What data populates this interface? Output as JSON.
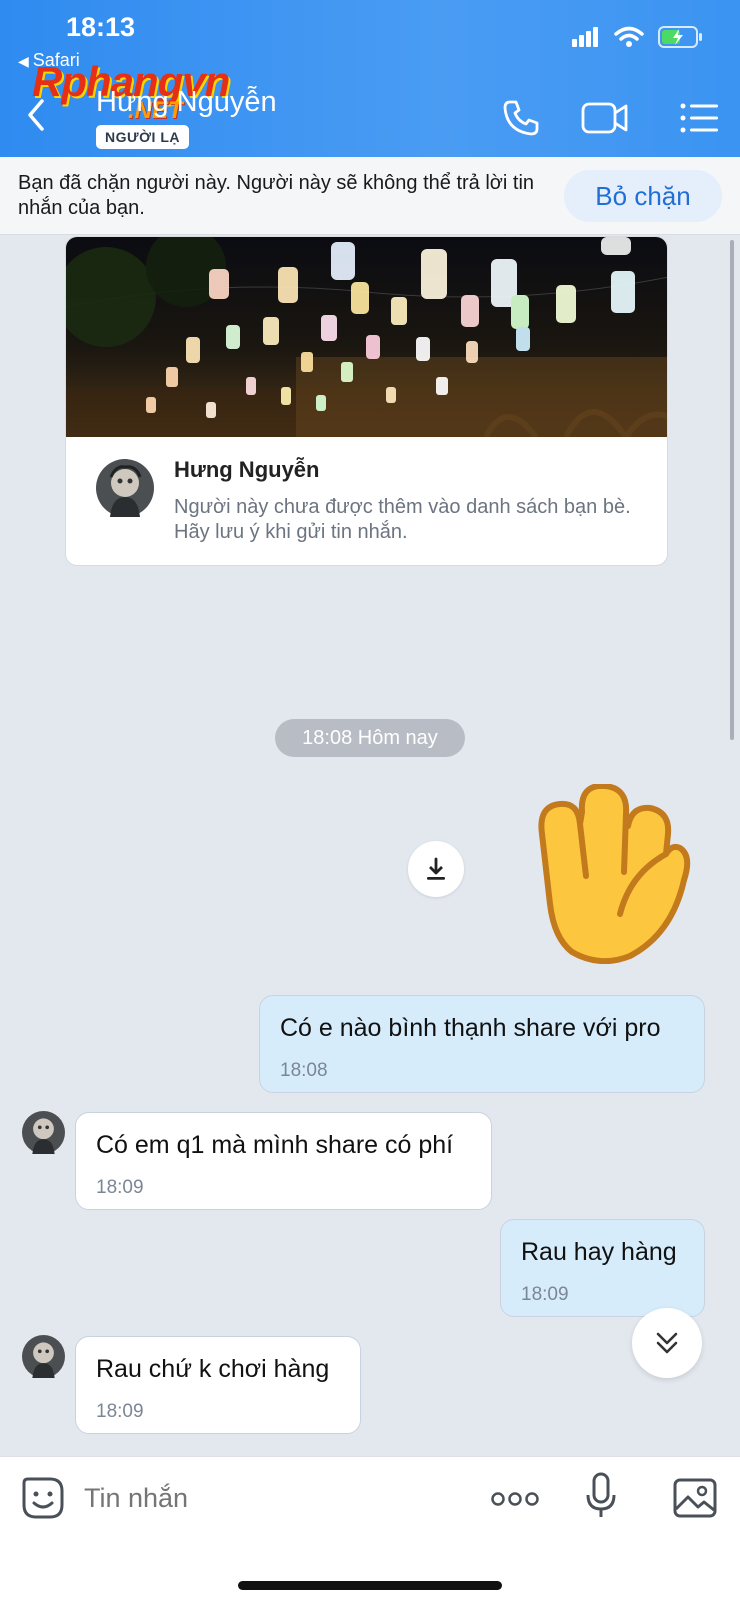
{
  "status_bar": {
    "time": "18:13",
    "back_app": "Safari"
  },
  "watermark": {
    "brand": "Rphangvn",
    "suffix": ".NET"
  },
  "header": {
    "contact_name": "Hưng Nguyễn",
    "badge": "NGƯỜI LẠ",
    "icons": [
      "back-icon",
      "phone-icon",
      "video-call-icon",
      "menu-list-icon"
    ]
  },
  "block_banner": {
    "text": "Bạn đã chặn người này. Người này sẽ không thể trả lời tin nhắn của bạn.",
    "unblock_label": "Bỏ chặn"
  },
  "profile_card": {
    "name": "Hưng Nguyễn",
    "note": "Người này chưa được thêm vào danh sách bạn bè. Hãy lưu ý khi gửi tin nhắn."
  },
  "date_separator": "18:08 Hôm nay",
  "messages": [
    {
      "sender": "me",
      "text": "Có e nào bình thạnh share với pro",
      "time": "18:08"
    },
    {
      "sender": "them",
      "text": "Có em q1 mà mình share có phí",
      "time": "18:09"
    },
    {
      "sender": "me",
      "text": "Rau hay hàng",
      "time": "18:09"
    },
    {
      "sender": "them",
      "text": "Rau chứ k chơi hàng",
      "time": "18:09"
    }
  ],
  "input_bar": {
    "placeholder": "Tin nhắn"
  },
  "colors": {
    "header": "#3b94f2",
    "my_bubble": "#d6ecfb",
    "their_bubble": "#ffffff",
    "chat_bg": "#e3e8ef",
    "accent": "#1f6fd6"
  }
}
